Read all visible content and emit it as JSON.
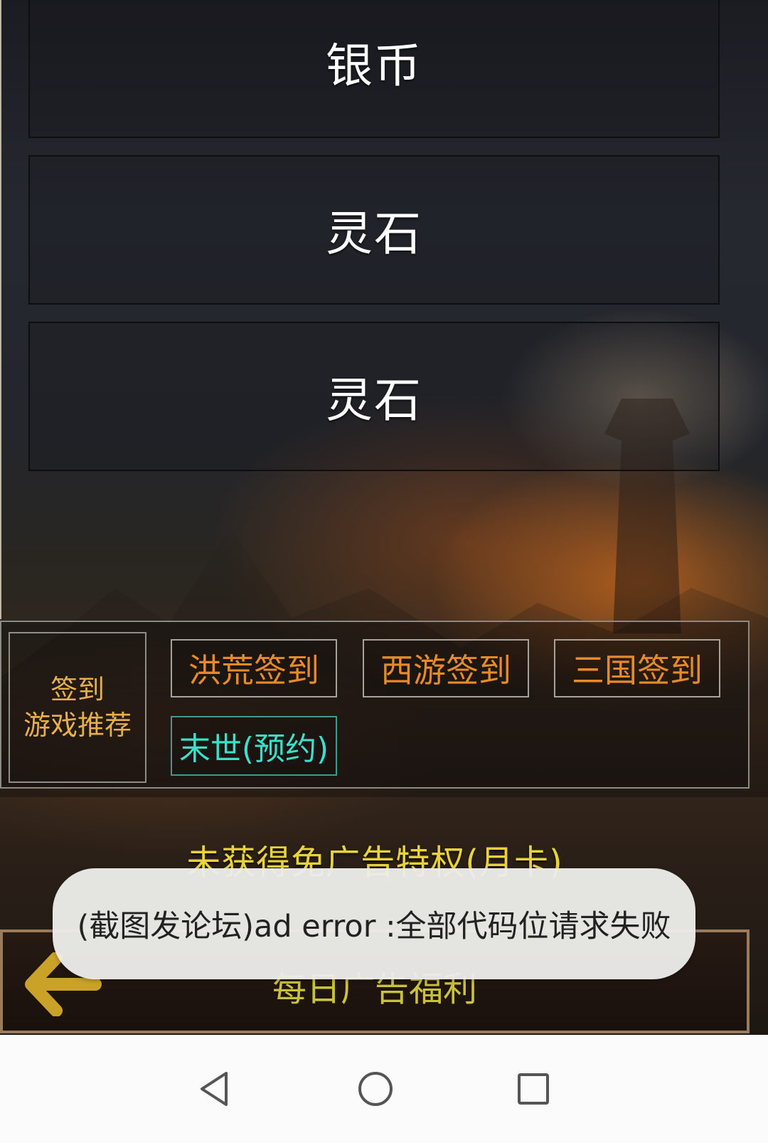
{
  "list": {
    "items": [
      {
        "label": "银币"
      },
      {
        "label": "灵石"
      },
      {
        "label": "灵石"
      }
    ]
  },
  "signin_panel": {
    "label_line1": "签到",
    "label_line2": "游戏推荐",
    "buttons": [
      {
        "label": "洪荒签到"
      },
      {
        "label": "西游签到"
      },
      {
        "label": "三国签到"
      },
      {
        "label": "末世(预约)"
      }
    ]
  },
  "notice": {
    "text": "未获得免广告特权(月卡)"
  },
  "bottom_bar": {
    "title": "每日广告福利",
    "back_icon": "arrow-left-icon"
  },
  "toast": {
    "message": "(截图发论坛)ad error :全部代码位请求失败"
  },
  "system_nav": {
    "back": "triangle-back-icon",
    "home": "circle-home-icon",
    "recent": "square-recent-icon"
  },
  "colors": {
    "gold": "#e7b04b",
    "orange": "#e78a2a",
    "cyan": "#39e0cc",
    "yellow": "#e8d33a"
  }
}
